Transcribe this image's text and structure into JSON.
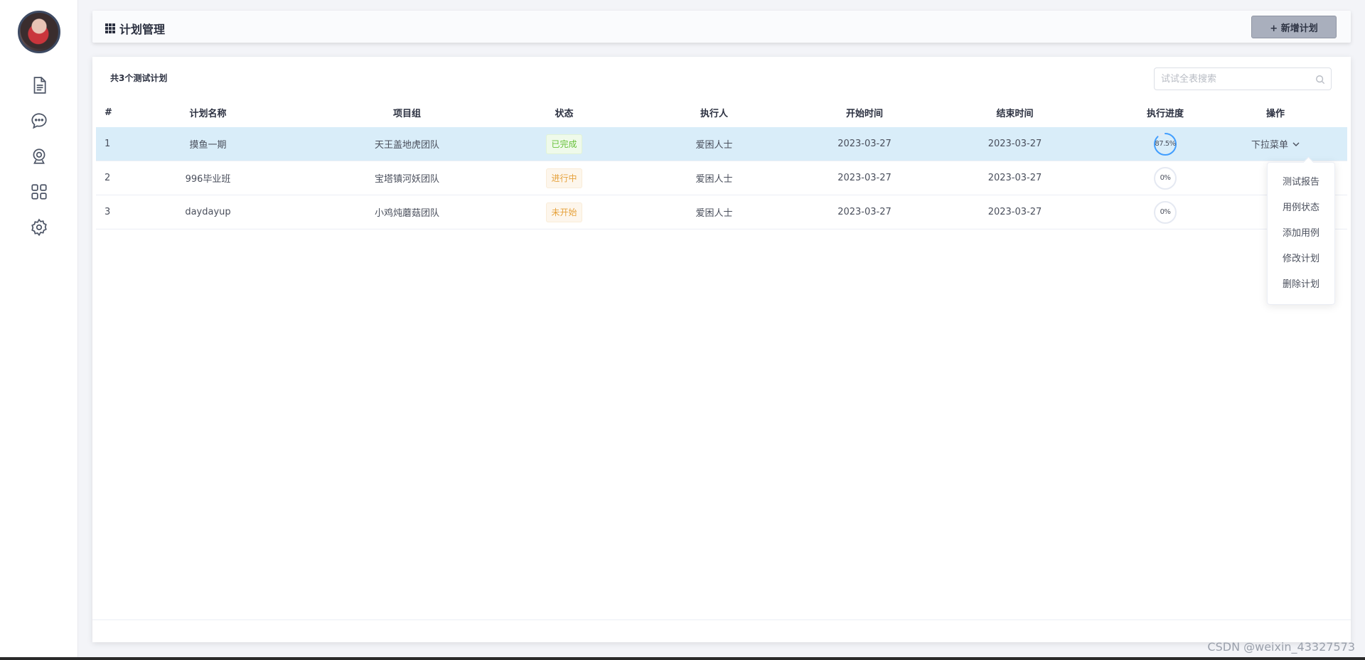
{
  "header": {
    "title": "计划管理",
    "add_button": "+ 新增计划"
  },
  "toolbar": {
    "count_label": "共3个测试计划",
    "search_placeholder": "试试全表搜索"
  },
  "table": {
    "headers": [
      "#",
      "计划名称",
      "项目组",
      "状态",
      "执行人",
      "开始时间",
      "结束时间",
      "执行进度",
      "操作"
    ],
    "rows": [
      {
        "idx": "1",
        "name": "摸鱼一期",
        "group": "天王盖地虎团队",
        "status": "已完成",
        "status_type": "done",
        "executor": "爱困人士",
        "start": "2023-03-27",
        "end": "2023-03-27",
        "progress_text": "87.5%",
        "progress": 0.875,
        "op": "下拉菜单"
      },
      {
        "idx": "2",
        "name": "996毕业班",
        "group": "宝塔镇河妖团队",
        "status": "进行中",
        "status_type": "doing",
        "executor": "爱困人士",
        "start": "2023-03-27",
        "end": "2023-03-27",
        "progress_text": "0%",
        "progress": 0,
        "op": ""
      },
      {
        "idx": "3",
        "name": "daydayup",
        "group": "小鸡炖蘑菇团队",
        "status": "未开始",
        "status_type": "todo",
        "executor": "爱困人士",
        "start": "2023-03-27",
        "end": "2023-03-27",
        "progress_text": "0%",
        "progress": 0,
        "op": ""
      }
    ]
  },
  "dropdown": {
    "items": [
      "测试报告",
      "用例状态",
      "添加用例",
      "修改计划",
      "删除计划"
    ]
  },
  "sidebar": {
    "icons": [
      "document-icon",
      "chat-icon",
      "webcam-icon",
      "apps-icon",
      "settings-icon"
    ]
  },
  "watermark": "CSDN @weixin_43327573",
  "colors": {
    "accent_blue": "#409eff",
    "row_hover": "#d9edf9",
    "success": "#67c23a",
    "warning": "#e6a23c"
  }
}
